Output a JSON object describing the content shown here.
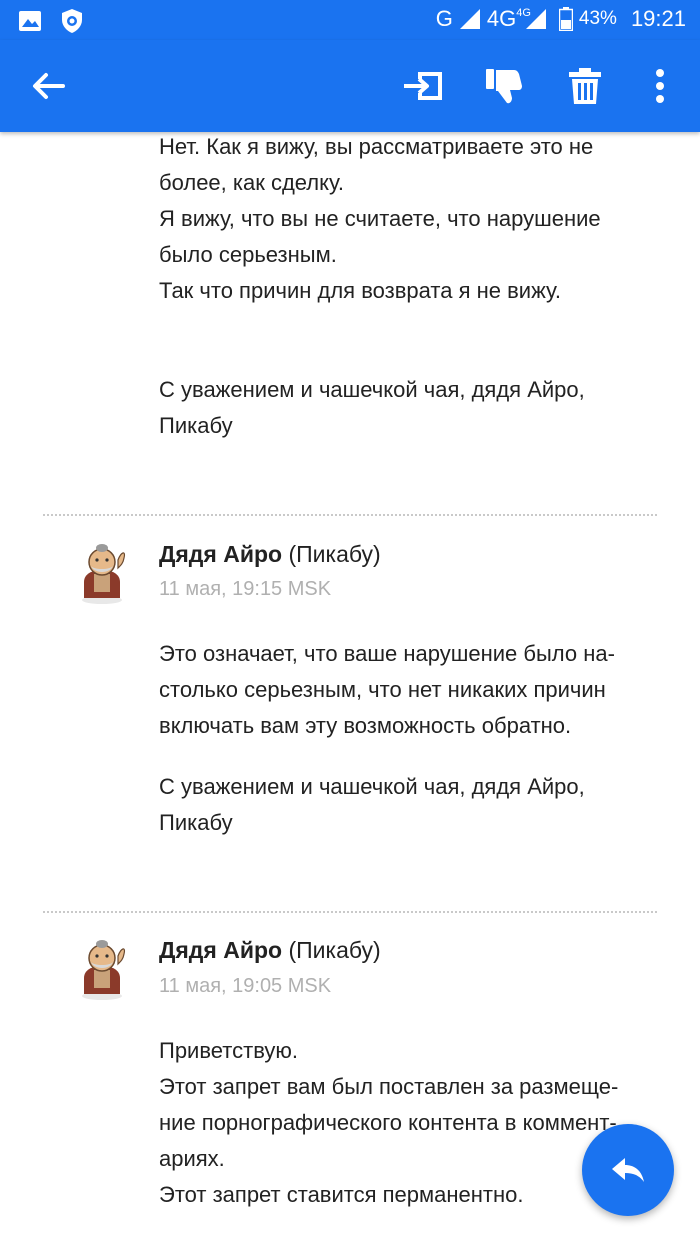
{
  "status_bar": {
    "network_g": "G",
    "network_4g": "4G",
    "network_4g_small": "4G",
    "battery": "43%",
    "time": "19:21"
  },
  "colors": {
    "accent": "#1a73f0",
    "text": "#222222",
    "muted": "#b0b0b0"
  },
  "app_bar": {
    "icons": [
      "back-arrow-icon",
      "move-to-icon",
      "thumbs-down-icon",
      "trash-icon",
      "more-vert-icon"
    ]
  },
  "messages": [
    {
      "lines": [
        "Нет. Как я вижу, вы рассматриваете это не",
        "более, как сделку.",
        "Я вижу, что вы не считаете, что нарушение",
        "было серьезным.",
        "Так что причин для возврата я не вижу."
      ],
      "signature": [
        "С уважением и чашечкой чая, дядя Айро,",
        "Пикабу"
      ]
    },
    {
      "author_name": "Дядя Айро",
      "author_suffix": " (Пикабу)",
      "date": "11 мая, 19:15 MSK",
      "lines": [
        "Это означает, что ваше нарушение было на-",
        "столько серьезным, что нет никаких причин",
        "включать вам эту возможность обратно."
      ],
      "signature": [
        "С уважением и чашечкой чая, дядя Айро,",
        "Пикабу"
      ]
    },
    {
      "author_name": "Дядя Айро",
      "author_suffix": " (Пикабу)",
      "date": "11 мая, 19:05 MSK",
      "lines": [
        "Приветствую.",
        "Этот запрет вам был поставлен за размеще-",
        "ние порнографического контента в коммент-",
        "ариях.",
        "Этот запрет ставится перманентно."
      ]
    }
  ],
  "fab": {
    "icon": "reply-icon"
  }
}
